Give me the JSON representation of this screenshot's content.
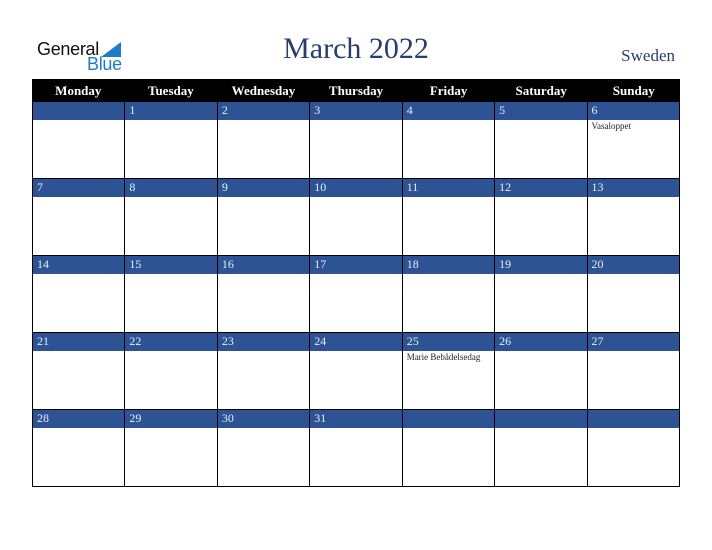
{
  "logo": {
    "line1": "General",
    "line2": "Blue"
  },
  "title": "March 2022",
  "country": "Sweden",
  "colors": {
    "header_bg": "#000000",
    "day_bar": "#2e5394",
    "title": "#253f6a",
    "logo_blue": "#1d7bc8"
  },
  "weekdays": [
    "Monday",
    "Tuesday",
    "Wednesday",
    "Thursday",
    "Friday",
    "Saturday",
    "Sunday"
  ],
  "weeks": [
    [
      {
        "day": ""
      },
      {
        "day": "1"
      },
      {
        "day": "2"
      },
      {
        "day": "3"
      },
      {
        "day": "4"
      },
      {
        "day": "5"
      },
      {
        "day": "6",
        "event": "Vasaloppet"
      }
    ],
    [
      {
        "day": "7"
      },
      {
        "day": "8"
      },
      {
        "day": "9"
      },
      {
        "day": "10"
      },
      {
        "day": "11"
      },
      {
        "day": "12"
      },
      {
        "day": "13"
      }
    ],
    [
      {
        "day": "14"
      },
      {
        "day": "15"
      },
      {
        "day": "16"
      },
      {
        "day": "17"
      },
      {
        "day": "18"
      },
      {
        "day": "19"
      },
      {
        "day": "20"
      }
    ],
    [
      {
        "day": "21"
      },
      {
        "day": "22"
      },
      {
        "day": "23"
      },
      {
        "day": "24"
      },
      {
        "day": "25",
        "event": "Marie Bebådelsedag"
      },
      {
        "day": "26"
      },
      {
        "day": "27"
      }
    ],
    [
      {
        "day": "28"
      },
      {
        "day": "29"
      },
      {
        "day": "30"
      },
      {
        "day": "31"
      },
      {
        "day": ""
      },
      {
        "day": ""
      },
      {
        "day": ""
      }
    ]
  ]
}
